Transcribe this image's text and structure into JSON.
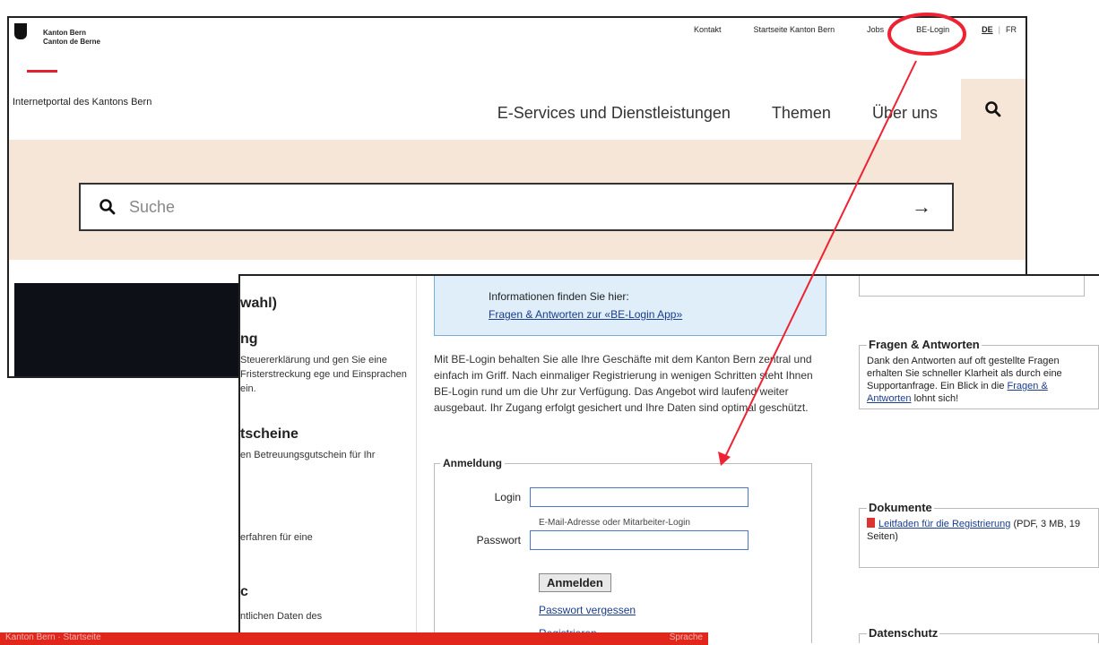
{
  "site": {
    "brand_line1": "Kanton Bern",
    "brand_line2": "Canton de Berne",
    "topnav": [
      "Kontakt",
      "Startseite Kanton Bern",
      "Jobs",
      "BE-Login"
    ],
    "lang_de": "DE",
    "lang_fr": "FR",
    "portal_title": "Internetportal des Kantons Bern",
    "mainnav": [
      "E-Services und Dienstleistungen",
      "Themen",
      "Über uns"
    ],
    "search_placeholder": "Suche"
  },
  "left": {
    "h1": "wahl)",
    "h2": "ng",
    "t2": "Steuererklärung und gen Sie eine Fristerstreckung ege und Einsprachen ein.",
    "h3": "tscheine",
    "t3": "en Betreuungsgutschein für Ihr",
    "t4": "erfahren für eine",
    "h5": "c",
    "t5": "ntlichen Daten des"
  },
  "info": {
    "line1": "Informationen finden Sie hier:",
    "link": "Fragen & Antworten zur «BE-Login App»"
  },
  "intro": "Mit BE-Login behalten Sie alle Ihre Geschäfte mit dem Kanton Bern zentral und einfach im Griff. Nach einmaliger Registrierung in wenigen Schritten steht Ihnen BE-Login rund um die Uhr zur Verfügung. Das Angebot wird laufend weiter ausgebaut. Ihr Zugang erfolgt gesichert und Ihre Daten sind optimal geschützt.",
  "login": {
    "legend": "Anmeldung",
    "login_label": "Login",
    "login_hint": "E-Mail-Adresse oder Mitarbeiter-Login",
    "password_label": "Passwort",
    "submit": "Anmelden",
    "forgot": "Passwort vergessen",
    "register": "Registrieren"
  },
  "faq": {
    "legend": "Fragen & Antworten",
    "text": "Dank den Antworten auf oft gestellte Fragen erhalten Sie schneller Klarheit als durch eine Supportanfrage. Ein Blick in die",
    "link": "Fragen & Antworten",
    "suffix": "lohnt sich!"
  },
  "docs": {
    "legend": "Dokumente",
    "link": "Leitfaden für die Registrierung",
    "meta": "(PDF, 3 MB, 19 Seiten)"
  },
  "privacy": {
    "legend": "Datenschutz"
  },
  "footer": {
    "left": "Kanton Bern · Startseite",
    "right": "Sprache"
  },
  "colors": {
    "accent_red": "#e4202e",
    "beige": "#f6e6d8",
    "info_blue": "#dfeef8",
    "link": "#1a3d8f"
  }
}
